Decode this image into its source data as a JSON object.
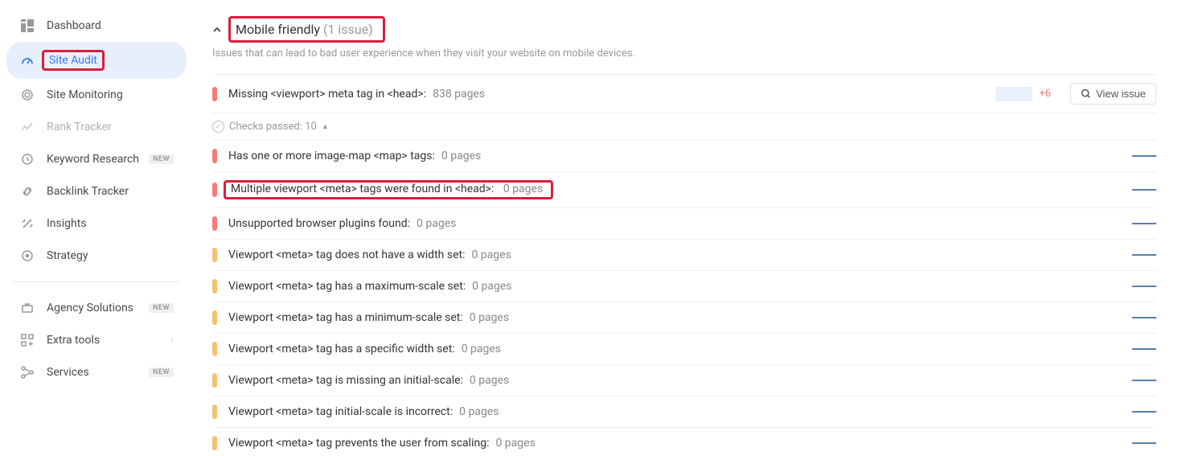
{
  "sidebar": {
    "items": [
      {
        "label": "Dashboard"
      },
      {
        "label": "Site Audit"
      },
      {
        "label": "Site Monitoring"
      },
      {
        "label": "Rank Tracker"
      },
      {
        "label": "Keyword Research",
        "new": "NEW"
      },
      {
        "label": "Backlink Tracker"
      },
      {
        "label": "Insights"
      },
      {
        "label": "Strategy"
      }
    ],
    "items2": [
      {
        "label": "Agency Solutions",
        "new": "NEW"
      },
      {
        "label": "Extra tools"
      },
      {
        "label": "Services",
        "new": "NEW"
      }
    ]
  },
  "section": {
    "title": "Mobile friendly",
    "count": "(1 issue)",
    "desc": "Issues that can lead to bad user experience when they visit your website on mobile devices."
  },
  "issues": [
    {
      "label": "Missing <viewport> meta tag in <head>:",
      "pages": "838 pages",
      "plus": "+6",
      "view": "View issue"
    }
  ],
  "checks": {
    "label": "Checks passed: 10"
  },
  "passed": [
    {
      "label": "Has one or more image-map <map> tags:",
      "pages": "0 pages"
    },
    {
      "label": "Multiple viewport <meta> tags were found in <head>:",
      "pages": "0 pages"
    },
    {
      "label": "Unsupported browser plugins found:",
      "pages": "0 pages"
    },
    {
      "label": "Viewport <meta> tag does not have a width set:",
      "pages": "0 pages"
    },
    {
      "label": "Viewport <meta> tag has a maximum-scale set:",
      "pages": "0 pages"
    },
    {
      "label": "Viewport <meta> tag has a minimum-scale set:",
      "pages": "0 pages"
    },
    {
      "label": "Viewport <meta> tag has a specific width set:",
      "pages": "0 pages"
    },
    {
      "label": "Viewport <meta> tag is missing an initial-scale:",
      "pages": "0 pages"
    },
    {
      "label": "Viewport <meta> tag initial-scale is incorrect:",
      "pages": "0 pages"
    },
    {
      "label": "Viewport <meta> tag prevents the user from scaling:",
      "pages": "0 pages"
    }
  ]
}
